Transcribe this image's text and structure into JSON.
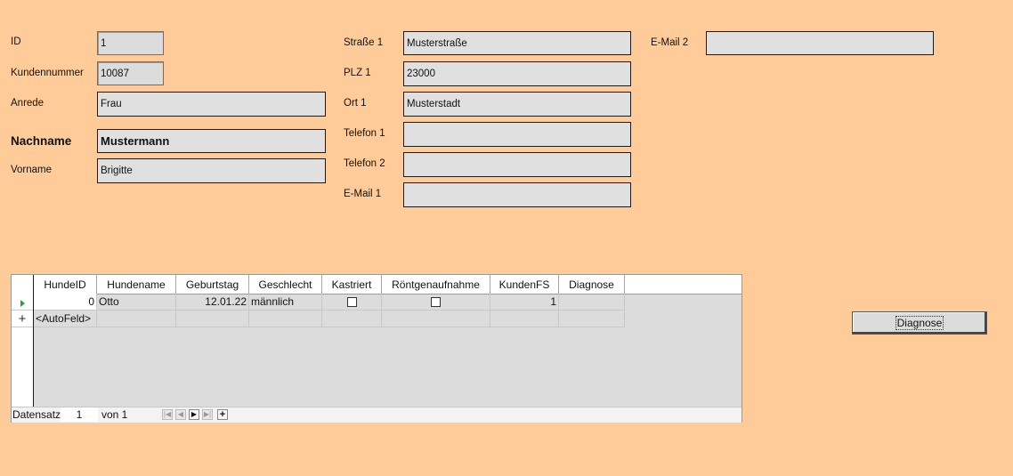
{
  "form": {
    "id": {
      "label": "ID",
      "value": "1"
    },
    "kundennummer": {
      "label": "Kundennummer",
      "value": "10087"
    },
    "anrede": {
      "label": "Anrede",
      "value": "Frau"
    },
    "nachname": {
      "label": "Nachname",
      "value": "Mustermann"
    },
    "vorname": {
      "label": "Vorname",
      "value": "Brigitte"
    },
    "strasse1": {
      "label": "Straße 1",
      "value": "Musterstraße"
    },
    "plz1": {
      "label": "PLZ 1",
      "value": "23000"
    },
    "ort1": {
      "label": "Ort 1",
      "value": "Musterstadt"
    },
    "telefon1": {
      "label": "Telefon 1",
      "value": ""
    },
    "telefon2": {
      "label": "Telefon 2",
      "value": ""
    },
    "email1": {
      "label": "E-Mail 1",
      "value": ""
    },
    "email2": {
      "label": "E-Mail 2",
      "value": ""
    }
  },
  "grid": {
    "columns": [
      "HundeID",
      "Hundename",
      "Geburtstag",
      "Geschlecht",
      "Kastriert",
      "Röntgenaufnahme",
      "KundenFS",
      "Diagnose"
    ],
    "rows": [
      {
        "HundeID": "0",
        "Hundename": "Otto",
        "Geburtstag": "12.01.22",
        "Geschlecht": "männlich",
        "Kastriert": false,
        "Roentgenaufnahme": false,
        "KundenFS": "1",
        "Diagnose": ""
      }
    ],
    "new_row": {
      "HundeID": "<AutoFeld>"
    },
    "current_row_icon": "triangle-right-icon",
    "new_row_icon": "plus-icon",
    "navigation": {
      "label": "Datensatz",
      "current": "1",
      "of_label": "von 1"
    }
  },
  "buttons": {
    "diagnose": "Diagnose"
  },
  "colors": {
    "background": "#ffcc99",
    "field": "#e0e0e0",
    "current_row_marker": "#2e9e3a"
  }
}
